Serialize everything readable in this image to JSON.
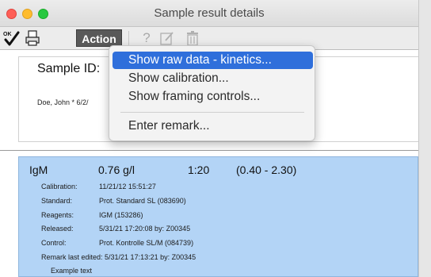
{
  "window": {
    "title": "Sample result details"
  },
  "toolbar": {
    "action_label": "Action",
    "help_symbol": "?",
    "icons": [
      "checkmark-ok-icon",
      "print-icon",
      "help-icon",
      "edit-icon",
      "trash-icon"
    ]
  },
  "sample": {
    "id_label": "Sample ID:",
    "patient": "Doe,  John   * 6/2/"
  },
  "menu": {
    "items": [
      {
        "label": "Show raw data - kinetics...",
        "highlighted": true
      },
      {
        "label": "Show calibration..."
      },
      {
        "label": "Show framing controls..."
      },
      {
        "label": "Enter remark..."
      }
    ]
  },
  "result": {
    "analyte": "IgM",
    "value": "0.76 g/l",
    "dilution": "1:20",
    "range": "(0.40 - 2.30)",
    "details": [
      {
        "key": "Calibration:",
        "value": "11/21/12 15:51:27"
      },
      {
        "key": "Standard:",
        "value": "Prot. Standard SL (083690)"
      },
      {
        "key": "Reagents:",
        "value": "IGM (153286)"
      },
      {
        "key": "Released:",
        "value": "5/31/21 17:20:08 by: Z00345"
      },
      {
        "key": "Control:",
        "value": "Prot. Kontrolle SL/M (084739)"
      }
    ],
    "remark_line": "Remark last edited:  5/31/21 17:13:21 by: Z00345",
    "example_text": "Example text"
  },
  "colors": {
    "selection_blue": "#b3d4f6",
    "menu_highlight": "#2f6fdb",
    "action_button": "#595959"
  }
}
